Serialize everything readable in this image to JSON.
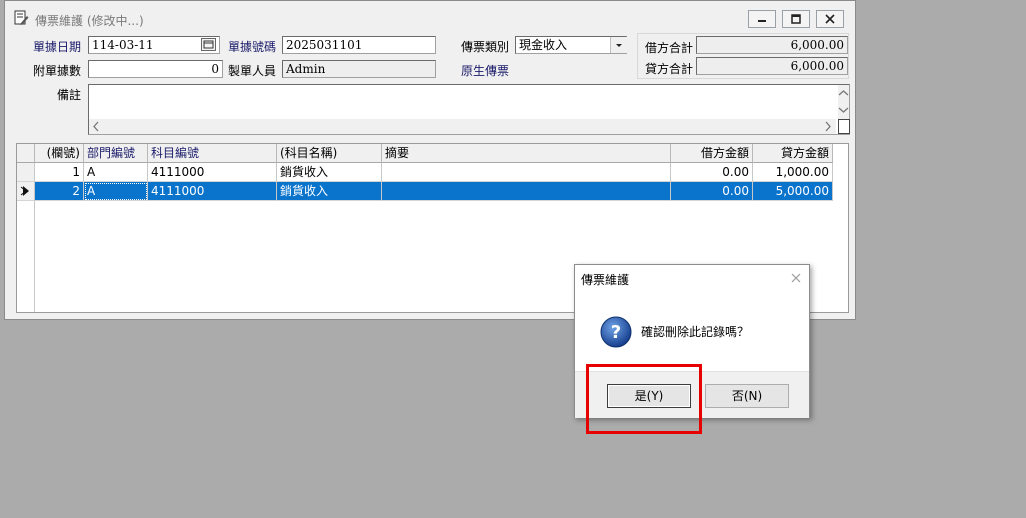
{
  "window": {
    "title": "傳票維護 (修改中...)"
  },
  "form": {
    "doc_date_label": "單據日期",
    "doc_date_value": "114-03-11",
    "doc_no_label": "單據號碼",
    "doc_no_value": "2025031101",
    "voucher_type_label": "傳票類別",
    "voucher_type_value": "現金收入",
    "attach_count_label": "附單據數",
    "attach_count_value": "0",
    "creator_label": "製單人員",
    "creator_value": "Admin",
    "original_voucher_link": "原生傳票",
    "remark_label": "備註",
    "remark_value": "",
    "debit_total_label": "借方合計",
    "debit_total_value": "6,000.00",
    "credit_total_label": "貸方合計",
    "credit_total_value": "6,000.00"
  },
  "grid": {
    "columns": [
      "(欄號)",
      "部門編號",
      "科目編號",
      "(科目名稱)",
      "摘要",
      "借方金額",
      "貸方金額"
    ],
    "rows": [
      {
        "no": "1",
        "dept": "A",
        "account": "4111000",
        "name": "銷貨收入",
        "memo": "",
        "debit": "0.00",
        "credit": "1,000.00"
      },
      {
        "no": "2",
        "dept": "A",
        "account": "4111000",
        "name": "銷貨收入",
        "memo": "",
        "debit": "0.00",
        "credit": "5,000.00"
      }
    ],
    "selected_row": 2
  },
  "dialog": {
    "title": "傳票維護",
    "message": "確認刪除此記錄嗎？",
    "yes_label": "是(Y)",
    "no_label": "否(N)",
    "icon": "question-icon"
  },
  "colors": {
    "selection": "#0a73cc",
    "highlight_box": "#e60000",
    "label_text": "#1b1b6b"
  }
}
